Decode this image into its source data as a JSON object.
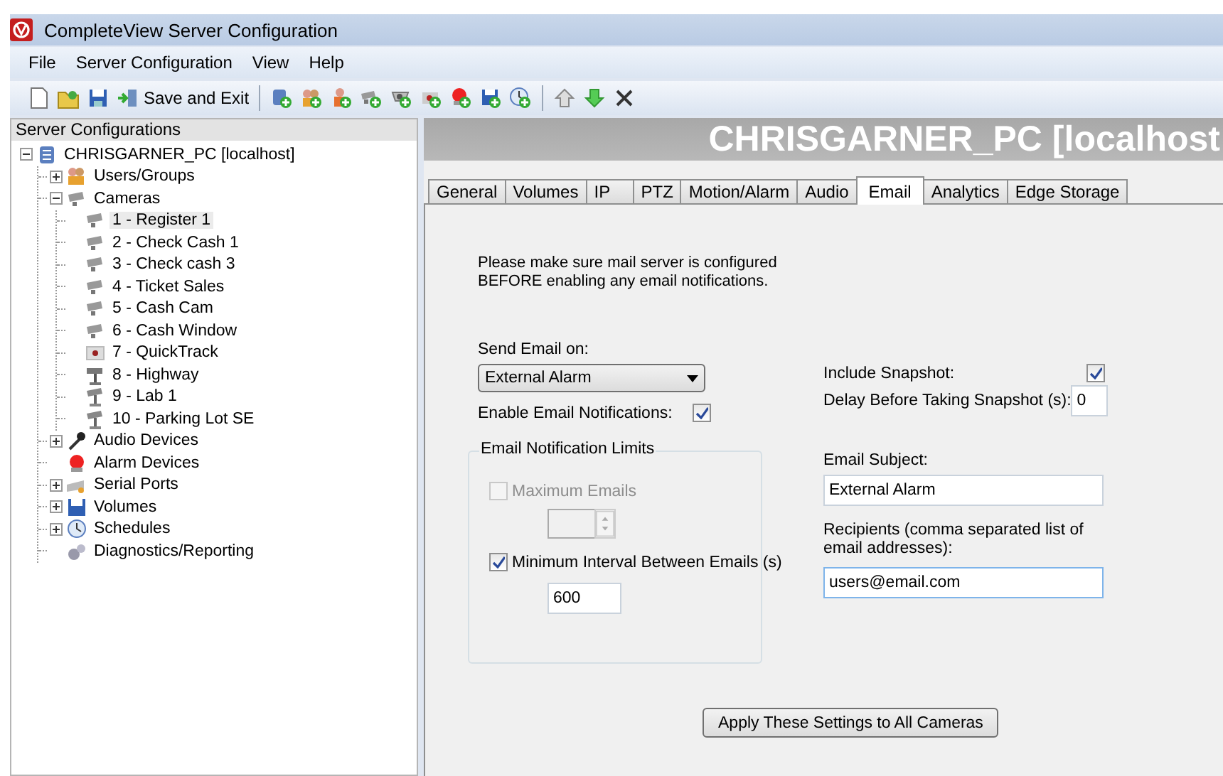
{
  "window": {
    "title": "CompleteView Server Configuration"
  },
  "menu": [
    {
      "label": "File"
    },
    {
      "label": "Server Configuration"
    },
    {
      "label": "View"
    },
    {
      "label": "Help"
    }
  ],
  "toolbar": {
    "save_exit_label": "Save and Exit"
  },
  "tree": {
    "header": "Server Configurations",
    "nodes": [
      {
        "label": "CHRISGARNER_PC [localhost]",
        "expanded": true,
        "selected": false,
        "children": [
          {
            "label": "Users/Groups",
            "expanded": false,
            "selected": false
          },
          {
            "label": "Cameras",
            "expanded": true,
            "selected": false,
            "children": [
              {
                "label": "1 - Register 1",
                "selected": true
              },
              {
                "label": "2 - Check Cash 1",
                "selected": false
              },
              {
                "label": "3 - Check cash 3",
                "selected": false
              },
              {
                "label": "4 - Ticket Sales",
                "selected": false
              },
              {
                "label": "5 - Cash Cam",
                "selected": false
              },
              {
                "label": "6 - Cash Window",
                "selected": false
              },
              {
                "label": "7 - QuickTrack",
                "selected": false
              },
              {
                "label": "8 - Highway",
                "selected": false
              },
              {
                "label": "9 - Lab 1",
                "selected": false
              },
              {
                "label": "10 - Parking Lot SE",
                "selected": false
              }
            ]
          },
          {
            "label": "Audio Devices",
            "expanded": false,
            "selected": false
          },
          {
            "label": "Alarm Devices",
            "selected": false
          },
          {
            "label": "Serial Ports",
            "expanded": false,
            "selected": false
          },
          {
            "label": "Volumes",
            "expanded": false,
            "selected": false
          },
          {
            "label": "Schedules",
            "expanded": false,
            "selected": false
          },
          {
            "label": "Diagnostics/Reporting",
            "selected": false
          }
        ]
      }
    ]
  },
  "banner": "CHRISGARNER_PC [localhost",
  "tabs": [
    {
      "label": "General",
      "selected": false
    },
    {
      "label": "Volumes",
      "selected": false
    },
    {
      "label": "IP",
      "selected": false
    },
    {
      "label": "PTZ",
      "selected": false
    },
    {
      "label": "Motion/Alarm",
      "selected": false
    },
    {
      "label": "Audio",
      "selected": false
    },
    {
      "label": "Email",
      "selected": true
    },
    {
      "label": "Analytics",
      "selected": false
    },
    {
      "label": "Edge Storage",
      "selected": false
    }
  ],
  "email": {
    "note": "Please make sure mail server is configured\nBEFORE enabling any email notifications.",
    "send_on": {
      "label": "Send Email on:",
      "value": "External Alarm"
    },
    "enable": {
      "label": "Enable Email Notifications:",
      "checked": true
    },
    "limits": {
      "title": "Email Notification Limits",
      "max_emails": {
        "label": "Maximum Emails",
        "checked": false,
        "disabled": true
      },
      "min_interval": {
        "label": "Minimum Interval Between Emails (s)",
        "checked": true,
        "disabled": false,
        "value": "600"
      }
    },
    "include_snapshot": {
      "label": "Include Snapshot:",
      "checked": true
    },
    "delay": {
      "label": "Delay Before Taking Snapshot (s):",
      "value": "0"
    },
    "subject": {
      "label": "Email Subject:",
      "value": "External Alarm"
    },
    "recipients": {
      "label": "Recipients (comma separated list of email addresses):",
      "value": "users@email.com"
    },
    "apply_button": "Apply These Settings to All Cameras"
  }
}
